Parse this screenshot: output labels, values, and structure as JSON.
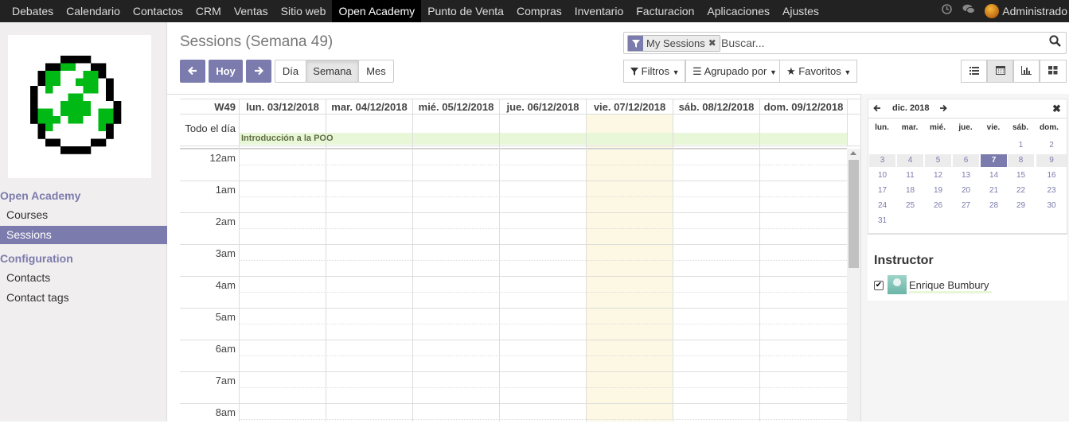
{
  "topbar": {
    "menu": [
      "Debates",
      "Calendario",
      "Contactos",
      "CRM",
      "Ventas",
      "Sitio web",
      "Open Academy",
      "Punto de Venta",
      "Compras",
      "Inventario",
      "Facturacion",
      "Aplicaciones",
      "Ajustes"
    ],
    "active_menu": "Open Academy",
    "user": "Administrado",
    "icons": [
      "clock-icon",
      "chat-icon"
    ]
  },
  "sidebar": {
    "logo": "pixel-egg-logo",
    "section1": "Open Academy",
    "items1": [
      "Courses",
      "Sessions"
    ],
    "active_item": "Sessions",
    "section2": "Configuration",
    "items2": [
      "Contacts",
      "Contact tags"
    ]
  },
  "control": {
    "breadcrumb": "Sessions (Semana 49)",
    "prev_icon": "arrow-left-icon",
    "today_label": "Hoy",
    "next_icon": "arrow-right-icon",
    "scale": [
      "Día",
      "Semana",
      "Mes"
    ],
    "active_scale": "Semana",
    "search": {
      "facet_icon": "filter-icon",
      "facet_label": "My Sessions",
      "placeholder": "Buscar..."
    },
    "filters_label": "Filtros",
    "groupby_label": "Agrupado por",
    "favorites_label": "Favoritos",
    "views": [
      "list-icon",
      "calendar-icon",
      "graph-icon",
      "pivot-icon"
    ],
    "active_view": "calendar-icon"
  },
  "calendar": {
    "week_label": "W49",
    "days": [
      "lun. 03/12/2018",
      "mar. 04/12/2018",
      "mié. 05/12/2018",
      "jue. 06/12/2018",
      "vie. 07/12/2018",
      "sáb. 08/12/2018",
      "dom. 09/12/2018"
    ],
    "today_index": 4,
    "allday_label": "Todo el día",
    "event": "Introducción a la POO",
    "hours": [
      "12am",
      "1am",
      "2am",
      "3am",
      "4am",
      "5am",
      "6am",
      "7am",
      "8am"
    ]
  },
  "datepicker": {
    "title": "dic. 2018",
    "dow": [
      "lun.",
      "mar.",
      "mié.",
      "jue.",
      "vie.",
      "sáb.",
      "dom."
    ],
    "weeks": [
      [
        "",
        "",
        "",
        "",
        "",
        "1",
        "2"
      ],
      [
        "3",
        "4",
        "5",
        "6",
        "7",
        "8",
        "9"
      ],
      [
        "10",
        "11",
        "12",
        "13",
        "14",
        "15",
        "16"
      ],
      [
        "17",
        "18",
        "19",
        "20",
        "21",
        "22",
        "23"
      ],
      [
        "24",
        "25",
        "26",
        "27",
        "28",
        "29",
        "30"
      ],
      [
        "31",
        "",
        "",
        "",
        "",
        "",
        ""
      ]
    ],
    "highlight_week": 1,
    "selected_day": "7"
  },
  "filter_panel": {
    "title": "Instructor",
    "entries": [
      {
        "name": "Enrique Bumbury",
        "checked": true
      }
    ]
  },
  "colors": {
    "accent": "#7c7bad",
    "topbar": "#222222",
    "event_bg": "#e9f7d9",
    "today_bg": "#fcf8e3"
  }
}
